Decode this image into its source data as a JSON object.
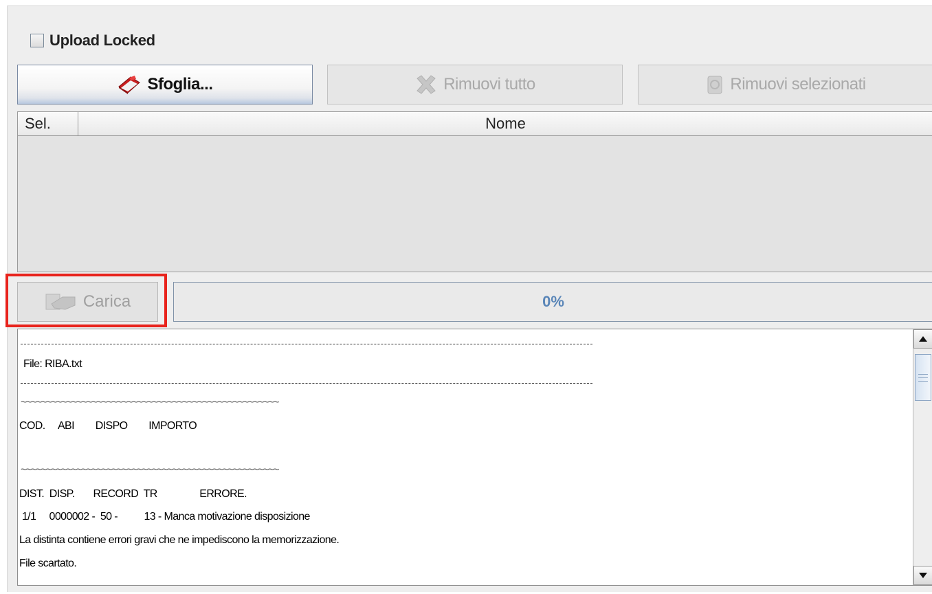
{
  "upload_locked": {
    "label": "Upload Locked",
    "checked": false
  },
  "toolbar": {
    "sfoglia": {
      "label": "Sfoglia...",
      "icon": "red-book-icon",
      "enabled": true
    },
    "rimuovi_tutto": {
      "label": "Rimuovi tutto",
      "icon": "x-icon",
      "enabled": false
    },
    "rimuovi_selezionati": {
      "label": "Rimuovi selezionati",
      "icon": "trash-icon",
      "enabled": false
    }
  },
  "file_table": {
    "columns": [
      "Sel.",
      "Nome"
    ],
    "rows": []
  },
  "carica": {
    "label": "Carica",
    "icon": "upload-hand-icon",
    "enabled": false,
    "highlight_color": "#e8231c"
  },
  "progress": {
    "value": 0,
    "text": "0%"
  },
  "log": {
    "file_line": "File: RIBA.txt",
    "header1": "COD.     ABI        DISPO        IMPORTO",
    "header2": "DIST.  DISP.       RECORD  TR                ERRORE.",
    "row1": " 1/1     0000002 -  50 -          13 - Manca motivazione disposizione",
    "msg1": "La distinta contiene errori gravi che ne impediscono la memorizzazione.",
    "msg2": "File scartato."
  },
  "colors": {
    "panel": "#eeeeee",
    "progress_text": "#5a86b8",
    "disabled_text": "#a9a9a9"
  }
}
